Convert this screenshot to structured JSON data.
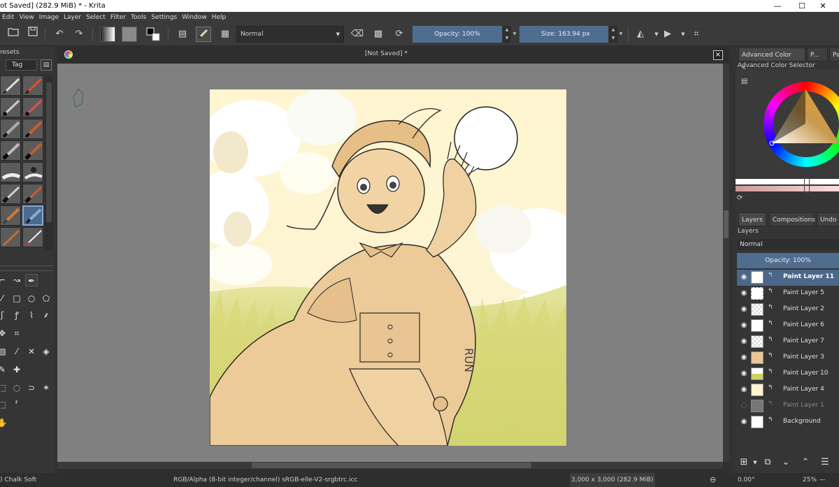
{
  "title_bar": {
    "text": "ot Saved]  (282.9 MiB)  * - Krita",
    "minimize": "—",
    "maximize": "☐",
    "close": "✕"
  },
  "menu": [
    "Edit",
    "View",
    "Image",
    "Layer",
    "Select",
    "Filter",
    "Tools",
    "Settings",
    "Window",
    "Help"
  ],
  "toolbar": {
    "blend_mode": "Normal",
    "opacity_label": "Opacity: 100%",
    "size_label": "Size: 163.94 px"
  },
  "left_dock": {
    "presets_header": "resets",
    "tag_label": "Tag"
  },
  "document": {
    "tab_title": "[Not Saved]  *",
    "close": "×"
  },
  "right_dock": {
    "color_tabs": [
      "Advanced Color S...",
      "P...",
      "Pa"
    ],
    "acs_title": "Advanced Color Selector",
    "layer_tabs": [
      "Layers",
      "Compositions",
      "Undo"
    ],
    "layers_label": "Layers",
    "blend_mode": "Normal",
    "opacity_label": "Opacity:  100%",
    "layers": [
      {
        "name": "Paint Layer 11",
        "selected": true,
        "visible": true
      },
      {
        "name": "Paint Layer 5",
        "selected": false,
        "visible": true
      },
      {
        "name": "Paint Layer 2",
        "selected": false,
        "visible": true
      },
      {
        "name": "Paint Layer 6",
        "selected": false,
        "visible": true
      },
      {
        "name": "Paint Layer 7",
        "selected": false,
        "visible": true
      },
      {
        "name": "Paint Layer 3",
        "selected": false,
        "visible": true
      },
      {
        "name": "Paint Layer 10",
        "selected": false,
        "visible": true
      },
      {
        "name": "Paint Layer 4",
        "selected": false,
        "visible": true
      },
      {
        "name": "Paint Layer 1",
        "selected": false,
        "visible": false
      },
      {
        "name": "Background",
        "selected": false,
        "visible": true
      }
    ]
  },
  "status": {
    "brush": ") Chalk Soft",
    "color_space": "RGB/Alpha (8-bit integer/channel)  sRGB-elle-V2-srgbtrc.icc",
    "dimensions": "3,000 x 3,000 (282.9 MiB)",
    "rotation": "0.00°",
    "zoom": "25%"
  },
  "colors": {
    "accent": "#4f6d8f",
    "bg_dark": "#323232"
  }
}
